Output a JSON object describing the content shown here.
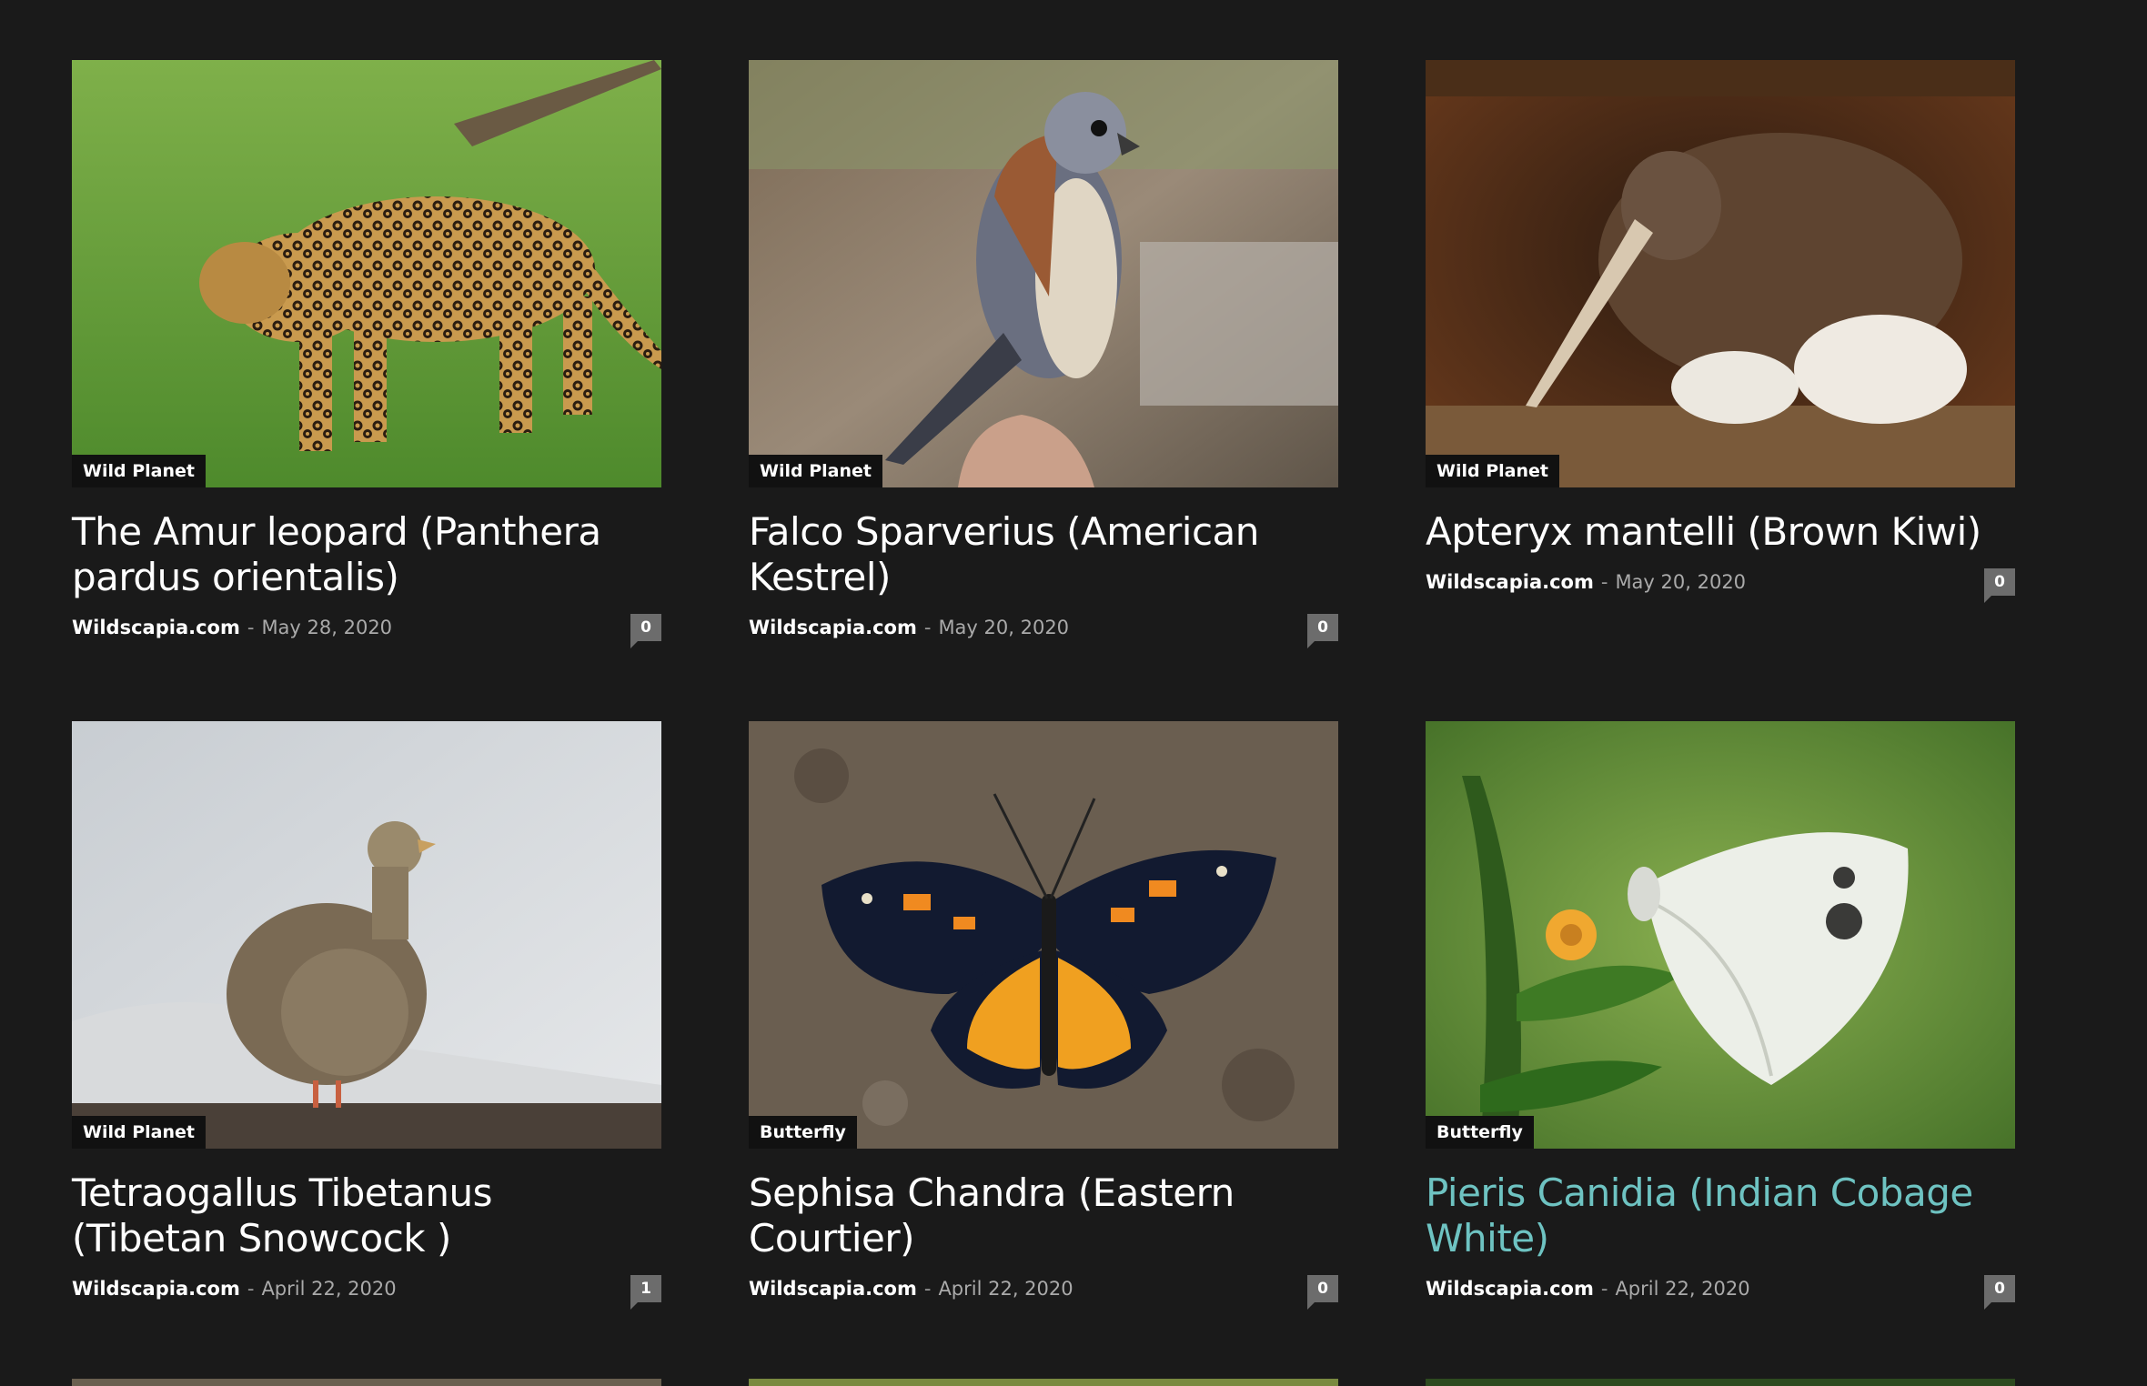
{
  "posts": [
    {
      "category": "Wild Planet",
      "title": "The Amur leopard (Panthera pardus orientalis)",
      "author": "Wildscapia.com",
      "separator": "-",
      "date": "May 28, 2020",
      "comments": "0"
    },
    {
      "category": "Wild Planet",
      "title": "Falco Sparverius (American Kestrel)",
      "author": "Wildscapia.com",
      "separator": "-",
      "date": "May 20, 2020",
      "comments": "0"
    },
    {
      "category": "Wild Planet",
      "title": "Apteryx mantelli (Brown Kiwi)",
      "author": "Wildscapia.com",
      "separator": "-",
      "date": "May 20, 2020",
      "comments": "0"
    },
    {
      "category": "Wild Planet",
      "title": "Tetraogallus Tibetanus (Tibetan Snowcock )",
      "author": "Wildscapia.com",
      "separator": "-",
      "date": "April 22, 2020",
      "comments": "1"
    },
    {
      "category": "Butterfly",
      "title": "Sephisa Chandra (Eastern Courtier)",
      "author": "Wildscapia.com",
      "separator": "-",
      "date": "April 22, 2020",
      "comments": "0"
    },
    {
      "category": "Butterfly",
      "title": "Pieris Canidia (Indian Cobage White)",
      "author": "Wildscapia.com",
      "separator": "-",
      "date": "April 22, 2020",
      "comments": "0"
    }
  ],
  "images": [
    {
      "icon": "leopard-photo"
    },
    {
      "icon": "kestrel-photo"
    },
    {
      "icon": "kiwi-photo"
    },
    {
      "icon": "snowcock-photo"
    },
    {
      "icon": "eastern-courtier-butterfly-photo"
    },
    {
      "icon": "cabbage-white-butterfly-photo"
    }
  ],
  "colors": {
    "background": "#1a1a1a",
    "title": "#ffffff",
    "title_hover": "#6ec3c2",
    "comment_badge": "#6c6c6c",
    "category_badge": "#111111"
  }
}
